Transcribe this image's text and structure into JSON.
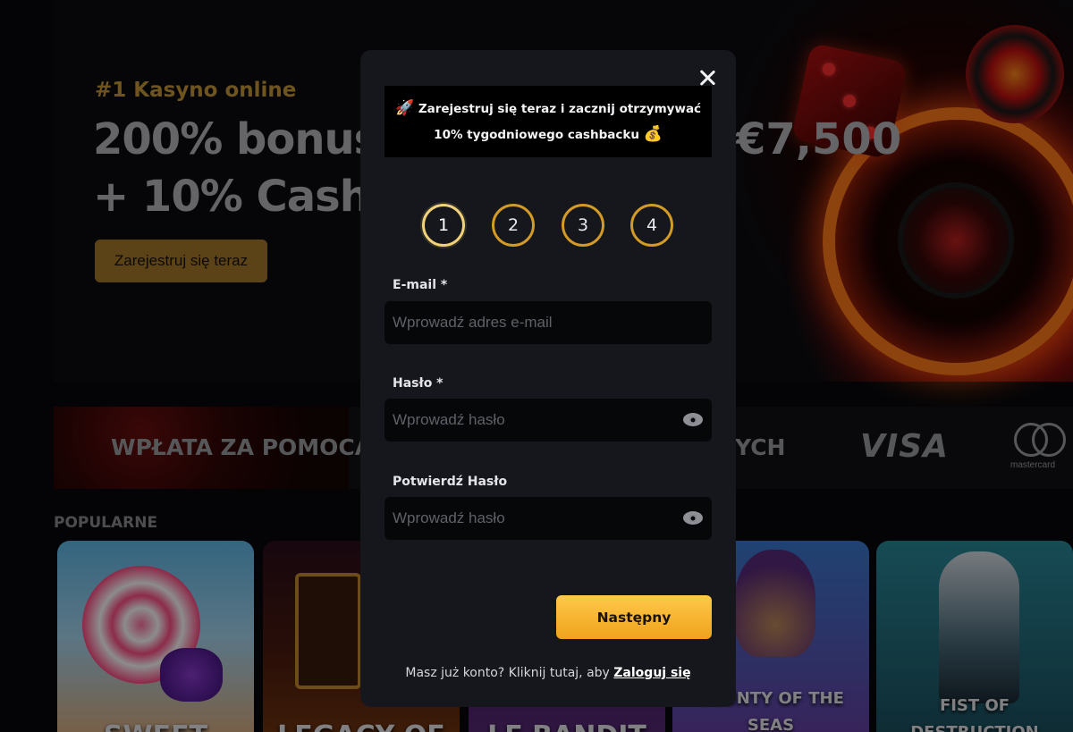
{
  "hero": {
    "kicker": "#1 Kasyno online",
    "title_line1": "200% bonusu",
    "title_amount": "€7,500",
    "title_line2": "+ 10% Cashb",
    "cta_label": "Zarejestruj się teraz"
  },
  "payments": {
    "banner_text": "WPŁATA ZA POMOCĄ",
    "banner_text_tail": "YCH",
    "brands": [
      "VISA",
      "mastercard"
    ]
  },
  "popular": {
    "section_title": "POPULARNE",
    "games": [
      "SWEET",
      "LEGACY OF",
      "LE BANDIT",
      "BOUNTY OF THE SEAS",
      "FIST OF DESTRUCTION"
    ]
  },
  "modal": {
    "promo_line1": "Zarejestruj się teraz i zacznij otrzymywać",
    "promo_line2": "10% tygodniowego cashbacku",
    "promo_emoji_rocket": "🚀",
    "promo_emoji_bag": "💰",
    "steps": [
      "1",
      "2",
      "3",
      "4"
    ],
    "active_step": "1",
    "email": {
      "label": "E-mail *",
      "placeholder": "Wprowadź adres e-mail",
      "value": ""
    },
    "password": {
      "label": "Hasło *",
      "placeholder": "Wprowadź hasło",
      "value": ""
    },
    "confirm_password": {
      "label": "Potwierdź Hasło",
      "placeholder": "Wprowadź hasło",
      "value": ""
    },
    "next_label": "Następny",
    "login_prompt": "Masz już konto? Kliknij tutaj, aby",
    "login_link": "Zaloguj się"
  },
  "colors": {
    "accent_gold": "#f0a21c",
    "step_border": "#d39b26",
    "modal_bg": "#15171d",
    "field_bg": "#060709"
  },
  "icons": [
    "close-icon",
    "eye-icon",
    "rocket-emoji",
    "money-bag-emoji"
  ]
}
